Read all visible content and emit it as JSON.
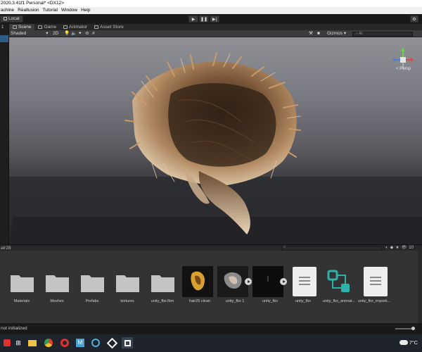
{
  "window": {
    "title": "2020.3.41f1 Personal* <DX12>"
  },
  "menu": {
    "items": [
      "achine",
      "Reallusion",
      "Tutorial",
      "Window",
      "Help"
    ]
  },
  "toolbar": {
    "local_label": "Local",
    "left_number": "1"
  },
  "tabs": [
    {
      "label": "Scene",
      "icon": "grid-icon",
      "active": true
    },
    {
      "label": "Game",
      "icon": "game-icon",
      "active": false
    },
    {
      "label": "Animator",
      "icon": "animator-icon",
      "active": false
    },
    {
      "label": "Asset Store",
      "icon": "store-icon",
      "active": false
    }
  ],
  "scene_toolbar": {
    "shading": "Shaded",
    "mode": "2D",
    "gizmos": "Gizmos",
    "search_placeholder": "All"
  },
  "viewport": {
    "projection_label": "< Persp"
  },
  "project": {
    "breadcrumb": "air28",
    "count": "10",
    "assets": [
      {
        "label": "Materials",
        "kind": "folder"
      },
      {
        "label": "Meshes",
        "kind": "folder"
      },
      {
        "label": "Prefabs",
        "kind": "folder"
      },
      {
        "label": "textures",
        "kind": "folder"
      },
      {
        "label": "unity_fbx.fbm",
        "kind": "folder"
      },
      {
        "label": "hair25 clean",
        "kind": "thumbnail"
      },
      {
        "label": "unity_fbx 1",
        "kind": "thumbnail"
      },
      {
        "label": "unity_fbx",
        "kind": "thumbnail"
      },
      {
        "label": "unity_fbx",
        "kind": "document"
      },
      {
        "label": "unity_fbx_animat...",
        "kind": "animator"
      },
      {
        "label": "unity_fbx_importi...",
        "kind": "document"
      }
    ]
  },
  "status": {
    "text": "not initialized"
  },
  "taskbar": {
    "temperature": "7°C"
  },
  "colors": {
    "accent": "#2c5d87",
    "teal": "#2bb3a9",
    "background": "#191919"
  }
}
